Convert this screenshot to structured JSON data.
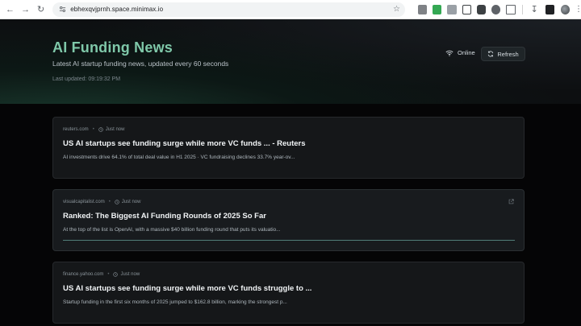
{
  "browser": {
    "url": "ebhexqvjprnh.space.minimax.io"
  },
  "header": {
    "title": "AI Funding News",
    "subtitle": "Latest AI startup funding news, updated every 60 seconds",
    "last_updated": "Last updated: 09:19:32 PM",
    "status_label": "Online",
    "refresh_label": "Refresh",
    "accent_color": "#7fc8a9"
  },
  "articles": [
    {
      "source": "reuters.com",
      "time": "Just now",
      "title": "US AI startups see funding surge while more VC funds ... - Reuters",
      "description": "AI investments drive 64.1% of total deal value in H1 2025 · VC fundraising declines 33.7% year-ov..."
    },
    {
      "source": "visualcapitalist.com",
      "time": "Just now",
      "title": "Ranked: The Biggest AI Funding Rounds of 2025 So Far",
      "description": "At the top of the list is OpenAI, with a massive $40 billion funding round that puts its valuatio..."
    },
    {
      "source": "finance.yahoo.com",
      "time": "Just now",
      "title": "US AI startups see funding surge while more VC funds struggle to ...",
      "description": "Startup funding in the first six months of 2025 jumped to $162.8 billion, marking the strongest p..."
    }
  ]
}
